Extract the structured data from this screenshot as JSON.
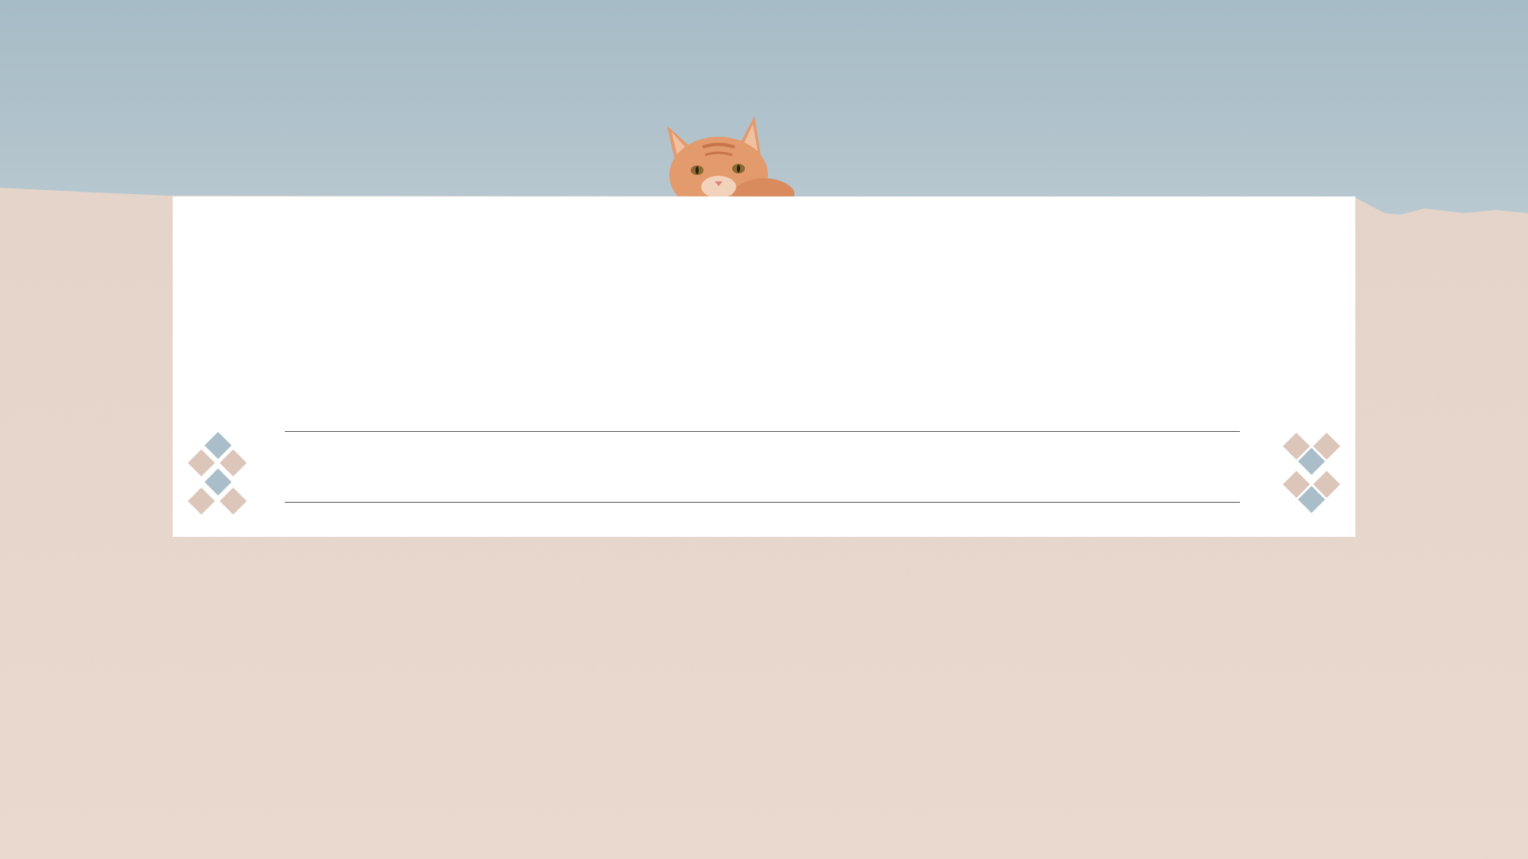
{
  "slide": {
    "background": {
      "sky_color": "#a9bec8",
      "wall_color": "#e7d6cb",
      "wall_shadow_color": "#d9c6b9"
    },
    "card": {
      "color": "#ffffff",
      "rule_color": "#555555"
    },
    "ornament": {
      "blue": "#a9bec8",
      "beige": "#dcc5b9"
    },
    "cat": {
      "fur_color": "#e39a6c",
      "dark_fur": "#c8754a",
      "eye_color": "#8a6a2e"
    }
  }
}
